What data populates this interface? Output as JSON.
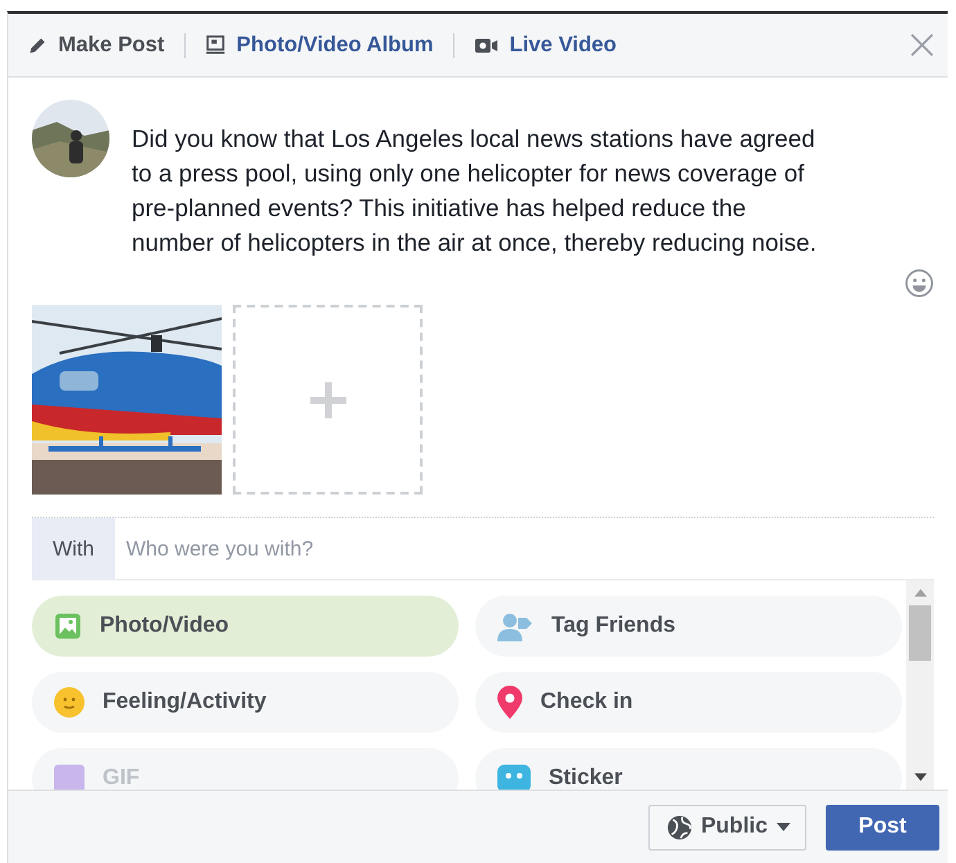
{
  "tabs": [
    {
      "label": "Make Post",
      "kind": "pencil",
      "selected": true
    },
    {
      "label": "Photo/Video Album",
      "kind": "album",
      "selected": false
    },
    {
      "label": "Live Video",
      "kind": "video",
      "selected": false
    }
  ],
  "post": {
    "text": "Did you know that Los Angeles local news stations have agreed to a press pool, using only one helicopter for news coverage of pre-planned events? This initiative has helped reduce the number of helicopters in the air at once, thereby reducing noise."
  },
  "with": {
    "label": "With",
    "placeholder": "Who were you with?"
  },
  "options": [
    {
      "label": "Photo/Video",
      "selected": true
    },
    {
      "label": "Tag Friends",
      "kind": "tag",
      "selected": false
    },
    {
      "label": "Feeling/Activity",
      "kind": "feeling",
      "selected": false
    },
    {
      "label": "Check in",
      "kind": "checkin",
      "selected": false
    },
    {
      "label": "GIF",
      "kind": "gif",
      "selected": false
    },
    {
      "label": "Sticker",
      "kind": "sticker",
      "selected": false
    }
  ],
  "footer": {
    "audience": "Public",
    "post_button": "Post"
  }
}
